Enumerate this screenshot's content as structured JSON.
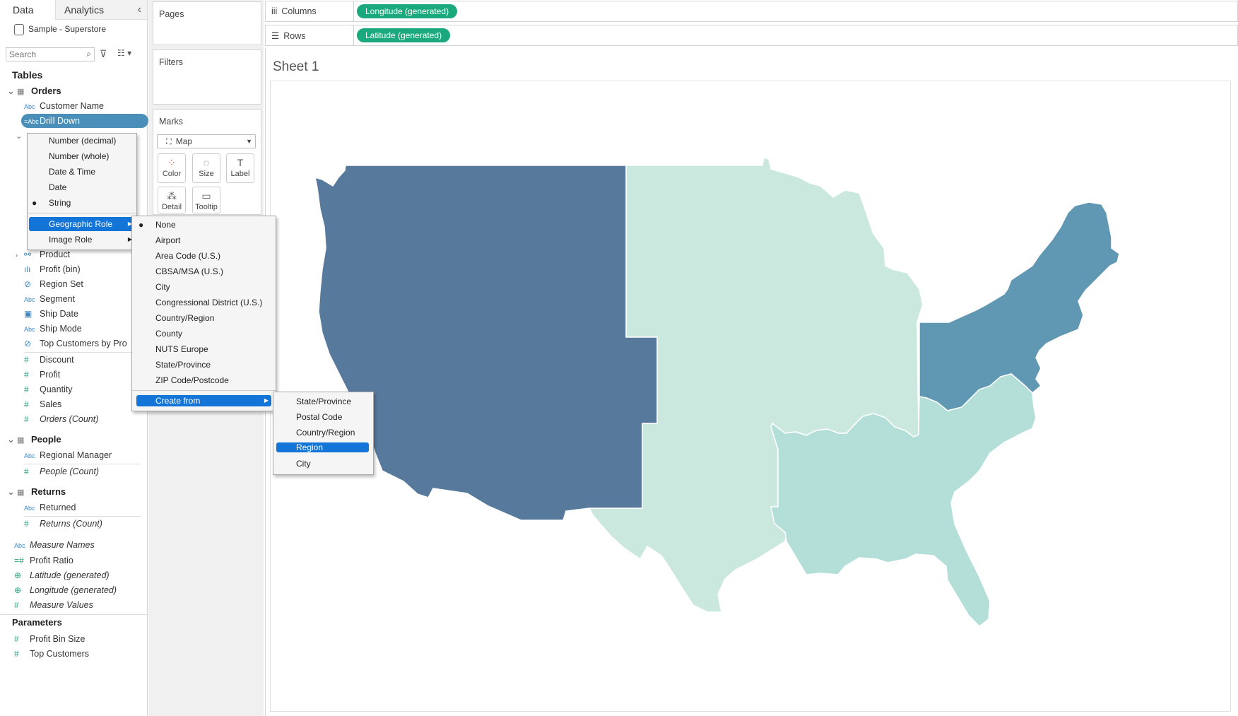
{
  "left_pane": {
    "tabs": {
      "data": "Data",
      "analytics": "Analytics",
      "collapse_icon": "‹"
    },
    "datasource": "Sample - Superstore",
    "search": {
      "placeholder": "Search",
      "value": ""
    },
    "tables_title": "Tables",
    "orders": {
      "name": "Orders",
      "fields": [
        {
          "icon": "Abc",
          "label": "Customer Name"
        },
        {
          "icon": "=Abc",
          "label": "Drill Down"
        },
        {
          "icon": "hierarchy",
          "label": "Product"
        },
        {
          "icon": "bin",
          "label": "Profit (bin)"
        },
        {
          "icon": "set",
          "label": "Region Set"
        },
        {
          "icon": "Abc",
          "label": "Segment"
        },
        {
          "icon": "date",
          "label": "Ship Date"
        },
        {
          "icon": "Abc",
          "label": "Ship Mode"
        },
        {
          "icon": "set",
          "label": "Top Customers by Pro"
        },
        {
          "icon": "#",
          "label": "Discount"
        },
        {
          "icon": "#",
          "label": "Profit"
        },
        {
          "icon": "#",
          "label": "Quantity"
        },
        {
          "icon": "#",
          "label": "Sales"
        },
        {
          "icon": "#",
          "label": "Orders (Count)"
        }
      ]
    },
    "people": {
      "name": "People",
      "fields": [
        {
          "icon": "Abc",
          "label": "Regional Manager"
        },
        {
          "icon": "#",
          "label": "People (Count)"
        }
      ]
    },
    "returns": {
      "name": "Returns",
      "fields": [
        {
          "icon": "Abc",
          "label": "Returned"
        },
        {
          "icon": "#",
          "label": "Returns (Count)"
        }
      ]
    },
    "other": [
      {
        "icon": "Abc",
        "label": "Measure Names"
      },
      {
        "icon": "=#",
        "label": "Profit Ratio"
      },
      {
        "icon": "globe",
        "label": "Latitude (generated)"
      },
      {
        "icon": "globe",
        "label": "Longitude (generated)"
      },
      {
        "icon": "#",
        "label": "Measure Values"
      }
    ],
    "parameters_title": "Parameters",
    "parameters": [
      {
        "icon": "#",
        "label": "Profit Bin Size"
      },
      {
        "icon": "#",
        "label": "Top Customers"
      }
    ]
  },
  "shelves": {
    "pages": "Pages",
    "filters": "Filters",
    "marks": "Marks",
    "mark_type": "Map",
    "mark_buttons": {
      "color": "Color",
      "size": "Size",
      "label": "Label",
      "detail": "Detail",
      "tooltip": "Tooltip"
    },
    "columns": {
      "label": "Columns",
      "pill": "Longitude (generated)"
    },
    "rows": {
      "label": "Rows",
      "pill": "Latitude (generated)"
    }
  },
  "sheet": {
    "title": "Sheet 1"
  },
  "context_menu": {
    "items": [
      "Number (decimal)",
      "Number (whole)",
      "Date & Time",
      "Date",
      "String",
      "Geographic Role",
      "Image Role"
    ],
    "checked": "String",
    "highlighted": "Geographic Role"
  },
  "geo_menu": {
    "items": [
      "None",
      "Airport",
      "Area Code (U.S.)",
      "CBSA/MSA (U.S.)",
      "City",
      "Congressional District (U.S.)",
      "Country/Region",
      "County",
      "NUTS Europe",
      "State/Province",
      "ZIP Code/Postcode",
      "Create from"
    ],
    "checked": "None",
    "highlighted": "Create from"
  },
  "create_from_menu": {
    "items": [
      "State/Province",
      "Postal Code",
      "Country/Region",
      "Region",
      "City"
    ],
    "highlighted": "Region"
  },
  "map": {
    "regions": [
      {
        "name": "West",
        "color": "#57799c"
      },
      {
        "name": "Central",
        "color": "#cbe8df"
      },
      {
        "name": "East",
        "color": "#6097b3"
      },
      {
        "name": "South",
        "color": "#b4dfd8"
      }
    ]
  }
}
